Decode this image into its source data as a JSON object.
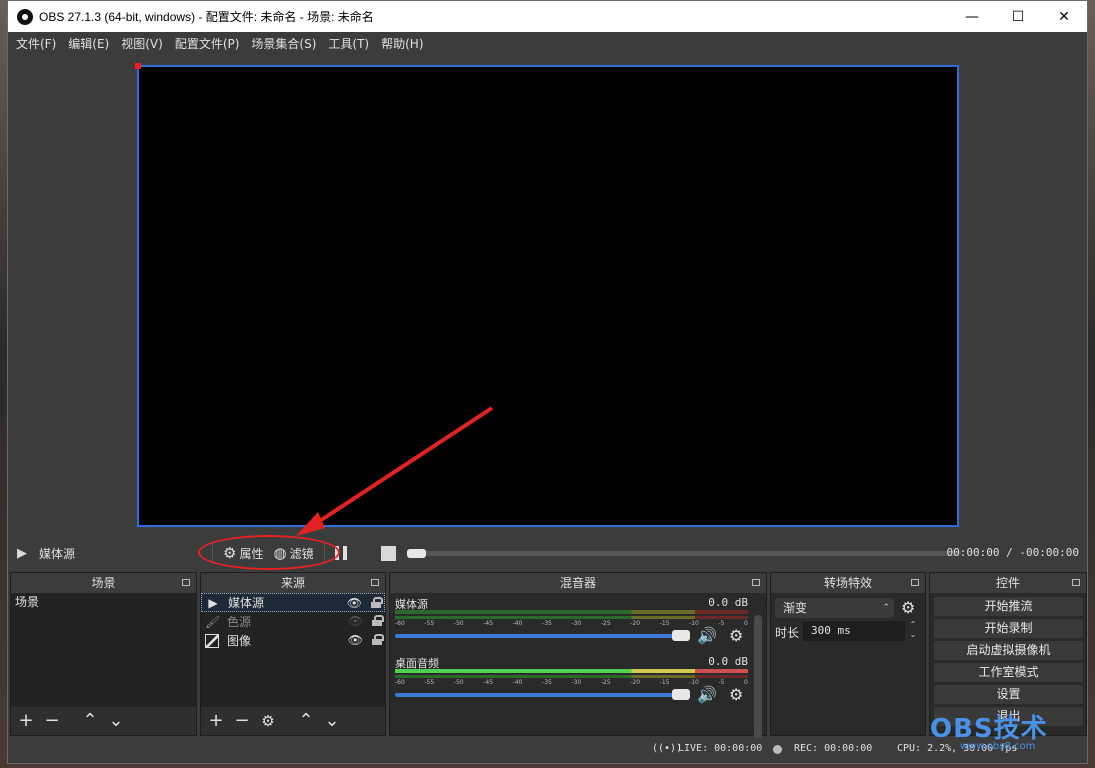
{
  "window": {
    "title": "OBS 27.1.3 (64-bit, windows) - 配置文件: 未命名 - 场景: 未命名",
    "controls": {
      "minimize": "—",
      "maximize": "☐",
      "close": "✕"
    }
  },
  "menu": [
    "文件(F)",
    "编辑(E)",
    "视图(V)",
    "配置文件(P)",
    "场景集合(S)",
    "工具(T)",
    "帮助(H)"
  ],
  "media_bar": {
    "source_name": "媒体源",
    "properties_label": "属性",
    "filters_label": "滤镜",
    "timecode": "00:00:00 / -00:00:00",
    "progress": 0
  },
  "docks": {
    "scenes": {
      "title": "场景",
      "items": [
        "场景"
      ]
    },
    "sources": {
      "title": "来源",
      "items": [
        {
          "name": "媒体源",
          "icon": "play-icon",
          "visible": true,
          "selected": true
        },
        {
          "name": "色源",
          "icon": "brush-icon",
          "visible": false,
          "selected": false
        },
        {
          "name": "图像",
          "icon": "image-icon",
          "visible": true,
          "selected": false
        }
      ]
    },
    "mixer": {
      "title": "混音器",
      "ticks": [
        "-60",
        "-55",
        "-50",
        "-45",
        "-40",
        "-35",
        "-30",
        "-25",
        "-20",
        "-15",
        "-10",
        "-5",
        "0"
      ],
      "channels": [
        {
          "name": "媒体源",
          "db": "0.0 dB"
        },
        {
          "name": "桌面音频",
          "db": "0.0 dB"
        }
      ]
    },
    "transitions": {
      "title": "转场特效",
      "selected": "渐变",
      "duration_label": "时长",
      "duration_value": "300 ms"
    },
    "controls": {
      "title": "控件",
      "buttons": [
        "开始推流",
        "开始录制",
        "启动虚拟摄像机",
        "工作室模式",
        "设置",
        "退出"
      ]
    }
  },
  "status": {
    "live": "LIVE: 00:00:00",
    "rec": "REC: 00:00:00",
    "cpu": "CPU: 2.2%, 30.00 fps"
  },
  "watermark": {
    "main": "OBS技术",
    "sub": "www.obs8.com"
  },
  "colors": {
    "accent": "#2f6ce0",
    "annotation": "#e42222",
    "watermark": "#4a92e8"
  }
}
